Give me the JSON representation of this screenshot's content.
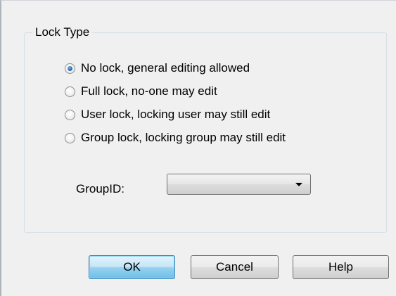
{
  "lock_type": {
    "title": "Lock Type",
    "options": [
      {
        "label": "No lock, general editing allowed",
        "checked": true
      },
      {
        "label": "Full lock, no-one may edit",
        "checked": false
      },
      {
        "label": "User lock, locking user may still edit",
        "checked": false
      },
      {
        "label": "Group lock, locking group may still edit",
        "checked": false
      }
    ],
    "group_id_label": "GroupID:",
    "group_id_value": ""
  },
  "buttons": {
    "ok": "OK",
    "cancel": "Cancel",
    "help": "Help"
  },
  "icons": {
    "combo_arrow": "chevron-down-icon"
  },
  "colors": {
    "dialog_bg": "#f0f0f0",
    "default_button_border": "#3c7fb1",
    "radio_dot": "#2f6fb5"
  }
}
